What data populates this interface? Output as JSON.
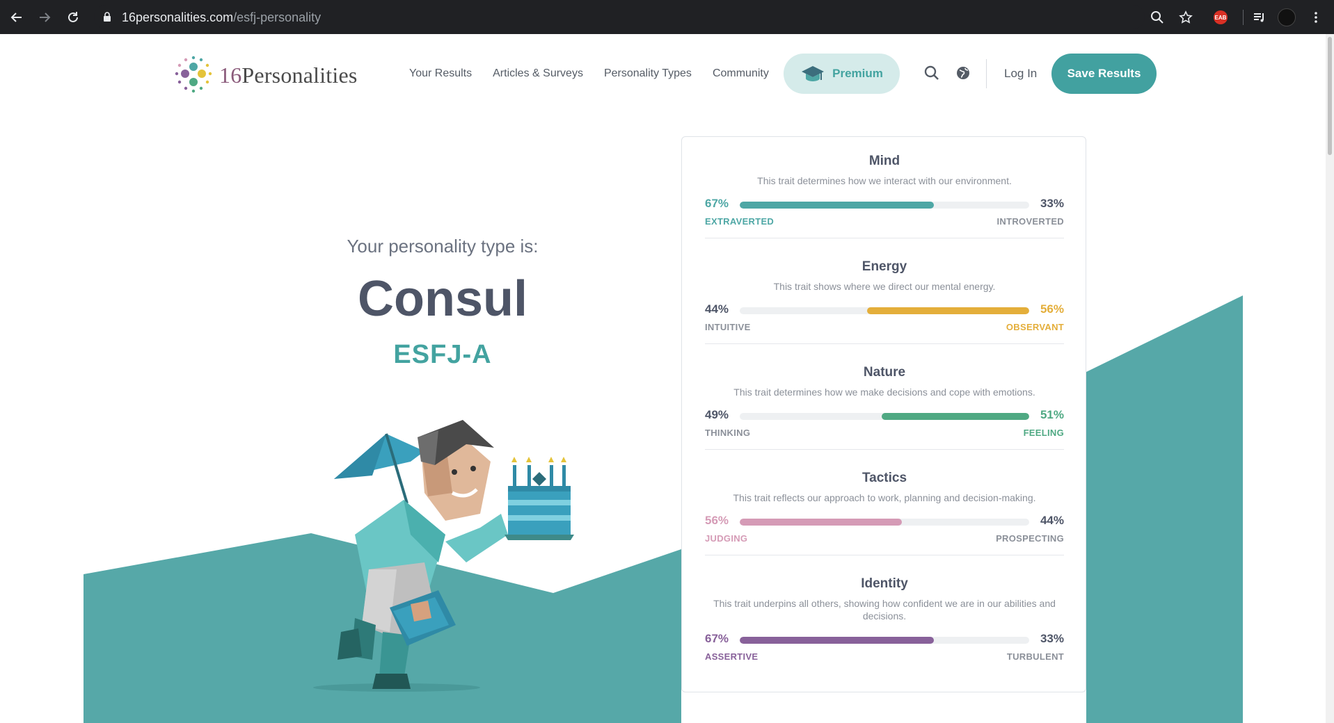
{
  "browser": {
    "url_domain": "16personalities.com",
    "url_path": "/esfj-personality",
    "ext_badge": "EAB"
  },
  "header": {
    "logo_num": "16",
    "logo_text": "Personalities",
    "nav": [
      "Your Results",
      "Articles & Surveys",
      "Personality Types",
      "Community"
    ],
    "premium_label": "Premium",
    "login_label": "Log In",
    "save_label": "Save Results"
  },
  "hero": {
    "intro": "Your personality type is:",
    "type_name": "Consul",
    "type_code": "ESFJ-A"
  },
  "traits": [
    {
      "title": "Mind",
      "desc": "This trait determines how we interact with our environment.",
      "left_pct": "67%",
      "right_pct": "33%",
      "left_label": "EXTRAVERTED",
      "right_label": "INTROVERTED",
      "dominant": "left",
      "value": 0.67,
      "color": "#4ea7a5"
    },
    {
      "title": "Energy",
      "desc": "This trait shows where we direct our mental energy.",
      "left_pct": "44%",
      "right_pct": "56%",
      "left_label": "INTUITIVE",
      "right_label": "OBSERVANT",
      "dominant": "right",
      "value": 0.56,
      "color": "#e4ae3a"
    },
    {
      "title": "Nature",
      "desc": "This trait determines how we make decisions and cope with emotions.",
      "left_pct": "49%",
      "right_pct": "51%",
      "left_label": "THINKING",
      "right_label": "FEELING",
      "dominant": "right",
      "value": 0.51,
      "color": "#4fa983"
    },
    {
      "title": "Tactics",
      "desc": "This trait reflects our approach to work, planning and decision-making.",
      "left_pct": "56%",
      "right_pct": "44%",
      "left_label": "JUDGING",
      "right_label": "PROSPECTING",
      "dominant": "left",
      "value": 0.56,
      "color": "#d59bb6"
    },
    {
      "title": "Identity",
      "desc": "This trait underpins all others, showing how confident we are in our abilities and decisions.",
      "left_pct": "67%",
      "right_pct": "33%",
      "left_label": "ASSERTIVE",
      "right_label": "TURBULENT",
      "dominant": "left",
      "value": 0.67,
      "color": "#88619a"
    }
  ],
  "colors": {
    "teal": "#42a1a0",
    "bg_teal": "#56a8a8",
    "text_dark": "#4e5567"
  }
}
